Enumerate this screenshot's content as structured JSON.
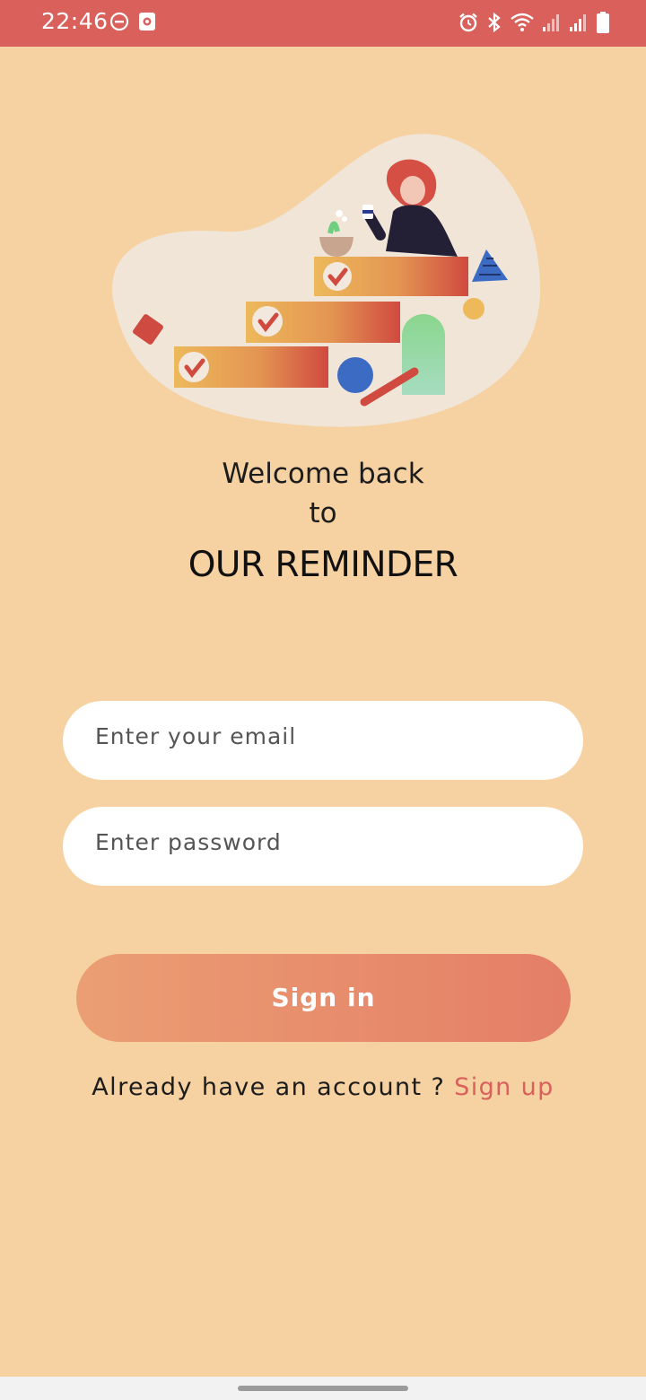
{
  "status_bar": {
    "time": "22:46",
    "left_icons": [
      "do-not-disturb-icon",
      "screen-record-icon"
    ],
    "right_icons": [
      "alarm-icon",
      "bluetooth-icon",
      "wifi-icon",
      "signal-icon",
      "signal-icon",
      "battery-icon"
    ]
  },
  "illustration": {
    "icon": "task-checklist-illustration"
  },
  "welcome": {
    "line1": "Welcome back",
    "line2": "to",
    "title": "OUR REMINDER"
  },
  "form": {
    "email_placeholder": "Enter your email",
    "password_placeholder": "Enter password",
    "signin_label": "Sign in"
  },
  "footer": {
    "prompt": "Already have an account ?",
    "link": "Sign up"
  },
  "colors": {
    "background": "#F6D1A1",
    "status_bar": "#D9605B",
    "accent": "#E47E67",
    "link": "#D9605B"
  }
}
